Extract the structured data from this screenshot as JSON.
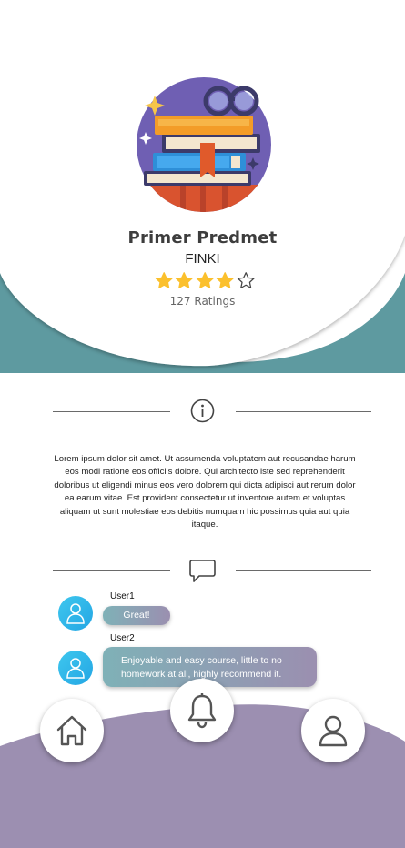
{
  "course": {
    "title": "Primer Predmet",
    "subtitle": "FINKI",
    "rating": 4,
    "max_rating": 5,
    "ratings_count": "127 Ratings"
  },
  "description": "Lorem ipsum dolor sit amet. Ut assumenda voluptatem aut recusandae harum eos modi ratione eos officiis dolore. Qui architecto iste sed reprehenderit doloribus ut eligendi minus eos vero dolorem qui dicta adipisci aut rerum dolor ea earum vitae. Est provident consectetur ut inventore autem et voluptas aliquam ut sunt molestiae eos debitis numquam hic possimus quia aut quia itaque.",
  "comments": [
    {
      "user": "User1",
      "text": "Great!"
    },
    {
      "user": "User2",
      "text": "Enjoyable and easy course, little to no homework at all, highly recommend it."
    }
  ],
  "icons": {
    "info": "info-icon",
    "comments": "chat-icon",
    "home": "home-icon",
    "notifications": "bell-icon",
    "profile": "user-icon",
    "avatar": "user-avatar-icon"
  },
  "colors": {
    "teal_wave": "#5e9aa0",
    "purple_footer": "#9c8fb1",
    "star": "#fbc02d",
    "avatar": "#2fb5ea"
  }
}
